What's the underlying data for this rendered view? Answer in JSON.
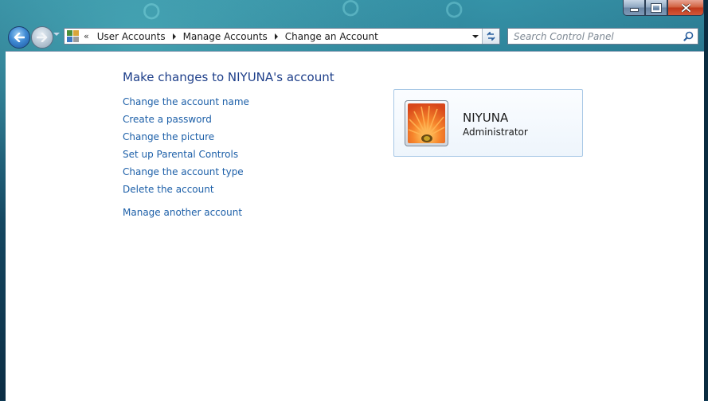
{
  "window": {
    "caption": {
      "minimize_icon": "minimize-icon",
      "maximize_icon": "maximize-icon",
      "close_icon": "close-icon",
      "close_color": "#c0381a"
    }
  },
  "nav": {
    "back_icon": "back-arrow-icon",
    "forward_icon": "forward-arrow-icon",
    "recent_icon": "chevron-down-icon"
  },
  "address_bar": {
    "icon": "control-panel-icon",
    "overflow_chevron": "«",
    "breadcrumbs": [
      "User Accounts",
      "Manage Accounts",
      "Change an Account"
    ],
    "refresh_icon": "refresh-icon"
  },
  "search": {
    "placeholder": "Search Control Panel",
    "value": "",
    "icon": "search-icon"
  },
  "main": {
    "heading": "Make changes to NIYUNA's account",
    "tasks": [
      "Change the account name",
      "Create a password",
      "Change the picture",
      "Set up Parental Controls",
      "Change the account type",
      "Delete the account"
    ],
    "secondary_task": "Manage another account",
    "link_color": "#1c5fa8",
    "heading_color": "#1e3f8a"
  },
  "account": {
    "name": "NIYUNA",
    "type": "Administrator",
    "picture": "orange-flower-avatar"
  }
}
